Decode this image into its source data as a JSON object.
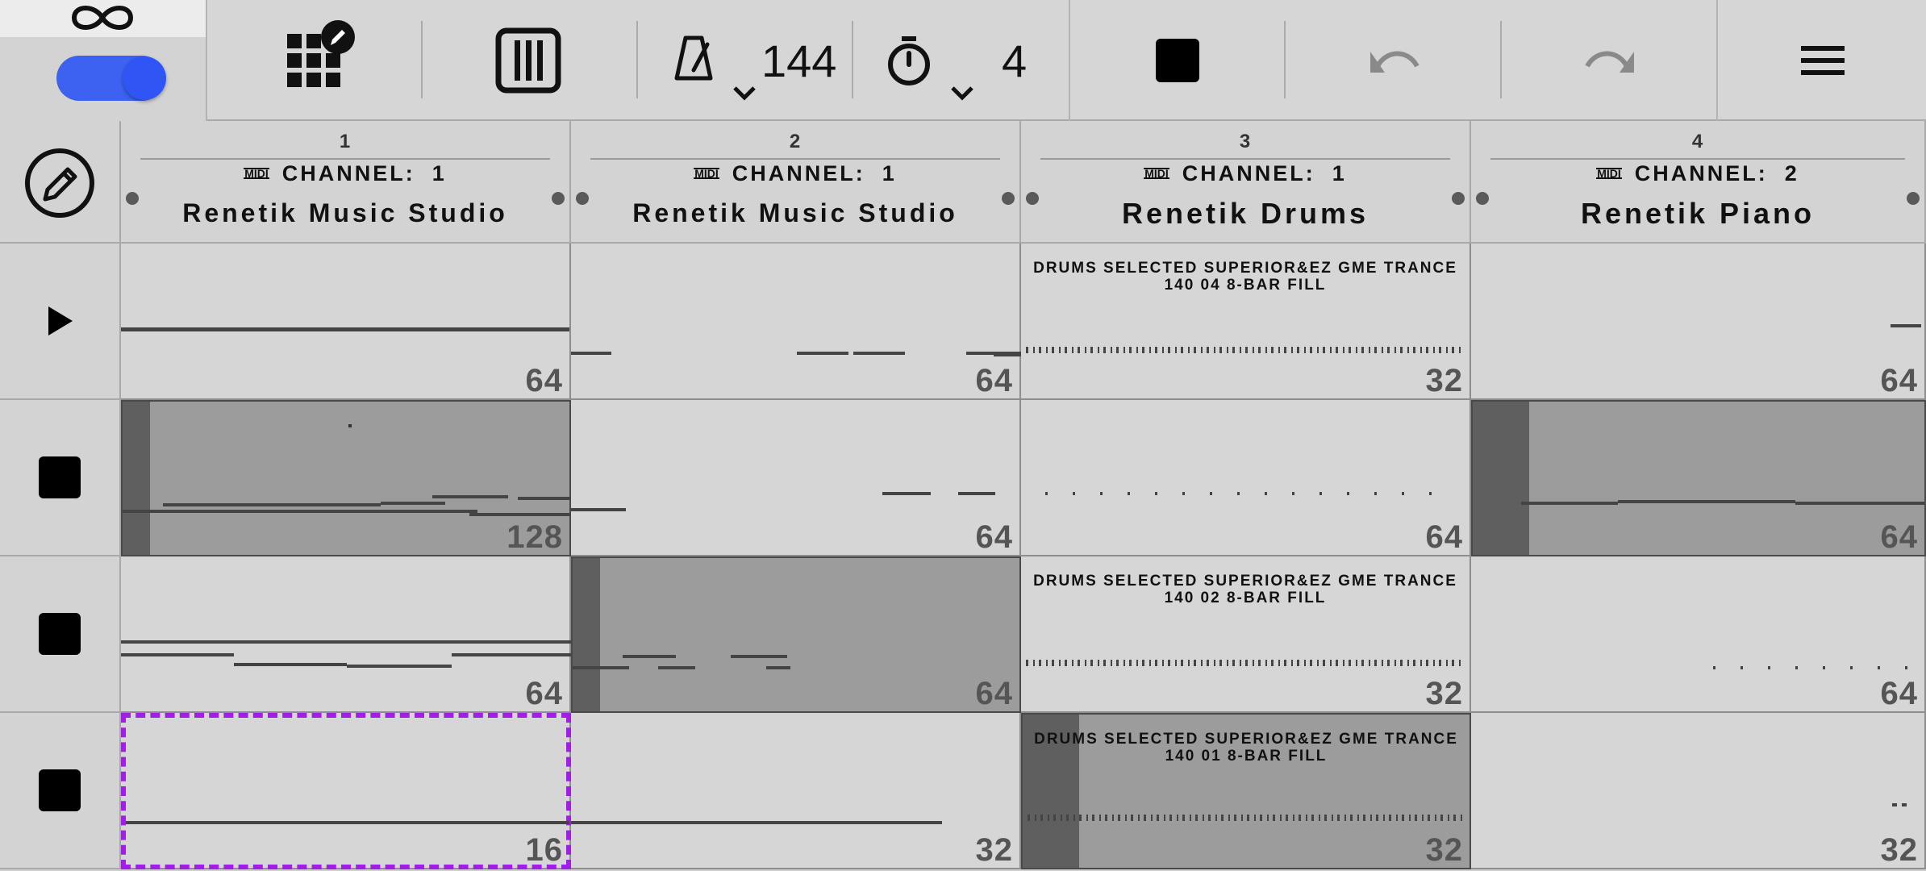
{
  "toolbar": {
    "tempo": "144",
    "count_in": "4",
    "loop_enabled": true,
    "accent_color": "#3d62f2",
    "icons": [
      "infinity-loop-icon",
      "grid-edit-icon",
      "piano-keys-icon",
      "metronome-icon",
      "timer-icon",
      "stop-icon",
      "undo-icon",
      "redo-icon",
      "menu-icon"
    ]
  },
  "tracks": [
    {
      "number": "1",
      "channel_label": "CHANNEL:",
      "channel": "1",
      "name": "Renetik Music Studio",
      "midi_badge": "MIDI"
    },
    {
      "number": "2",
      "channel_label": "CHANNEL:",
      "channel": "1",
      "name": "Renetik Music Studio",
      "midi_badge": "MIDI"
    },
    {
      "number": "3",
      "channel_label": "CHANNEL:",
      "channel": "1",
      "name": "Renetik Drums",
      "midi_badge": "MIDI"
    },
    {
      "number": "4",
      "channel_label": "CHANNEL:",
      "channel": "2",
      "name": "Renetik Piano",
      "midi_badge": "MIDI"
    }
  ],
  "scenes": [
    {
      "state": "play"
    },
    {
      "state": "stop"
    },
    {
      "state": "stop"
    },
    {
      "state": "stop"
    }
  ],
  "clips": [
    [
      {
        "length": "64",
        "title": ""
      },
      {
        "length": "64",
        "title": ""
      },
      {
        "length": "32",
        "title": "DRUMS SELECTED SUPERIOR&EZ GME TRANCE",
        "subtitle": "140 04 8-BAR FILL"
      },
      {
        "length": "64",
        "title": ""
      }
    ],
    [
      {
        "length": "128",
        "title": "",
        "playing": true
      },
      {
        "length": "64",
        "title": ""
      },
      {
        "length": "64",
        "title": ""
      },
      {
        "length": "64",
        "title": "",
        "playing": true
      }
    ],
    [
      {
        "length": "64",
        "title": ""
      },
      {
        "length": "64",
        "title": "",
        "playing": true
      },
      {
        "length": "32",
        "title": "DRUMS SELECTED SUPERIOR&EZ GME TRANCE",
        "subtitle": "140 02 8-BAR FILL"
      },
      {
        "length": "64",
        "title": ""
      }
    ],
    [
      {
        "length": "16",
        "title": "",
        "selected": true
      },
      {
        "length": "32",
        "title": ""
      },
      {
        "length": "32",
        "title": "DRUMS SELECTED SUPERIOR&EZ GME TRANCE",
        "subtitle": "140 01 8-BAR FILL",
        "playing": true
      },
      {
        "length": "32",
        "title": ""
      }
    ]
  ],
  "colors": {
    "selection": "#a01ee6",
    "playing_clip": "#9c9c9c",
    "background": "#d6d6d6"
  }
}
